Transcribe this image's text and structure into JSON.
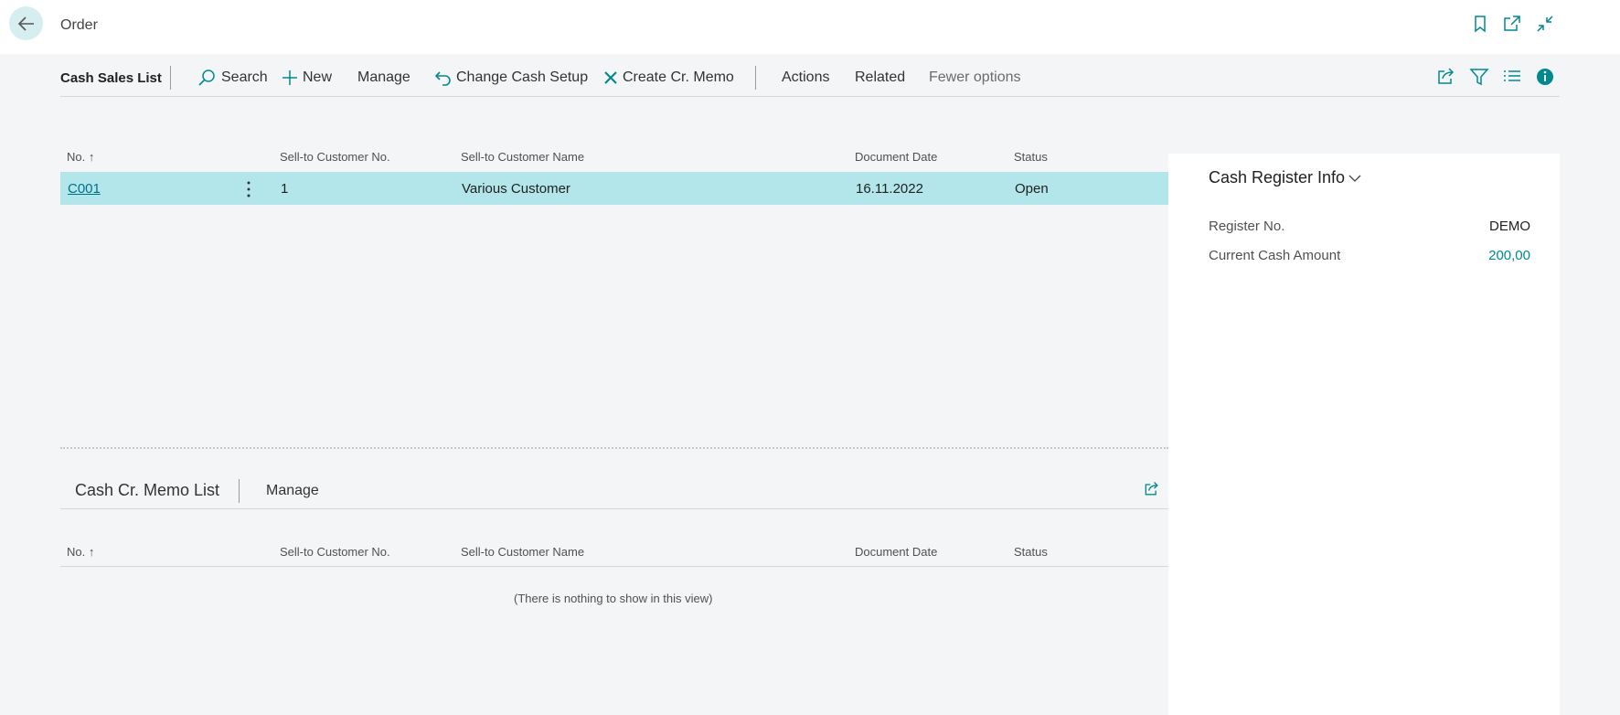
{
  "header": {
    "caption": "Order",
    "icons": [
      "back-arrow-icon",
      "bookmark-icon",
      "open-new-window-icon",
      "collapse-icon"
    ]
  },
  "actionbar": {
    "title": "Cash Sales List",
    "search": "Search",
    "new": "New",
    "manage": "Manage",
    "change_cash_setup": "Change Cash Setup",
    "create_cr_memo": "Create Cr. Memo",
    "actions": "Actions",
    "related": "Related",
    "fewer_options": "Fewer options",
    "right_icons": [
      "share-icon",
      "filter-icon",
      "list-view-icon",
      "info-icon"
    ]
  },
  "main_list": {
    "columns": [
      "No. ↑",
      "Sell-to Customer No.",
      "Sell-to Customer Name",
      "Document Date",
      "Status"
    ],
    "rows": [
      {
        "no": "C001",
        "customer_no": "1",
        "customer_name": "Various Customer",
        "document_date": "16.11.2022",
        "status": "Open"
      }
    ]
  },
  "sub_list": {
    "title": "Cash Cr. Memo List",
    "manage": "Manage",
    "columns": [
      "No. ↑",
      "Sell-to Customer No.",
      "Sell-to Customer Name",
      "Document Date",
      "Status"
    ],
    "empty_message": "(There is nothing to show in this view)"
  },
  "factbox": {
    "title": "Cash Register Info",
    "fields": [
      {
        "label": "Register No.",
        "value": "DEMO"
      },
      {
        "label": "Current Cash Amount",
        "value": "200,00"
      }
    ]
  },
  "colors": {
    "accent": "#00898f",
    "selected_row": "#b3e6ea",
    "back_button": "#d6eef0",
    "link": "#00708a"
  }
}
